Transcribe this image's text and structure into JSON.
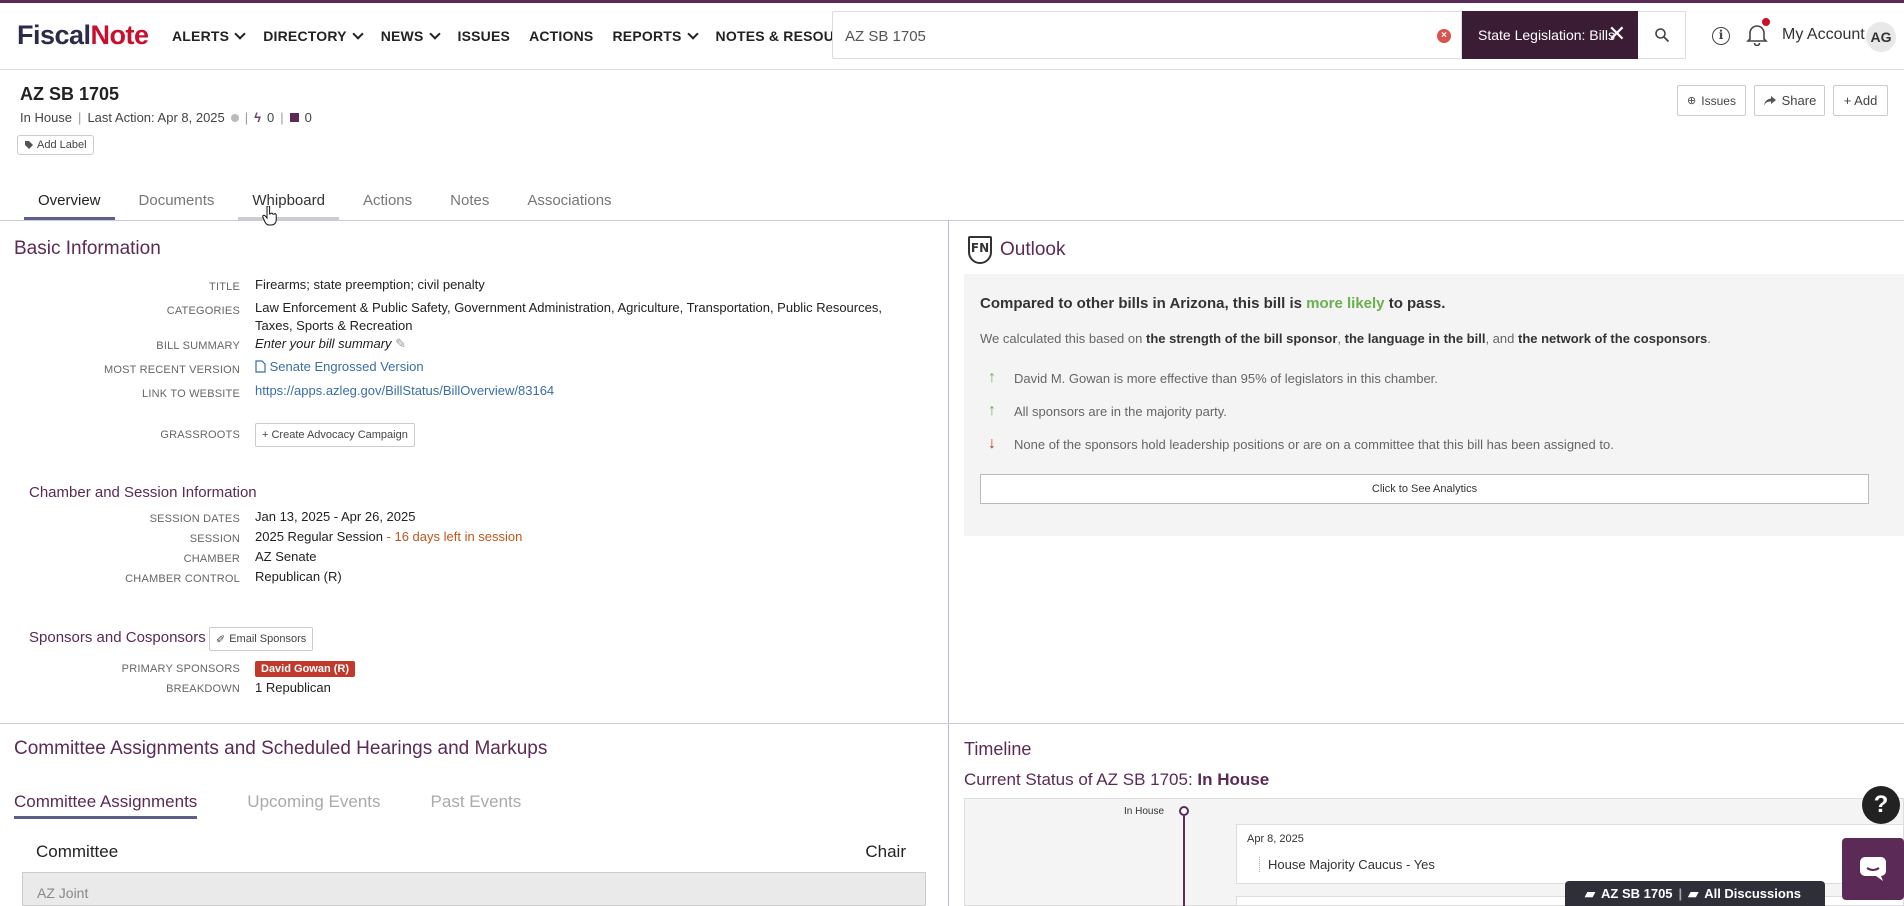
{
  "header": {
    "logo_fiscal": "Fiscal",
    "logo_note": "Note",
    "nav": [
      "ALERTS",
      "DIRECTORY",
      "NEWS",
      "ISSUES",
      "ACTIONS",
      "REPORTS",
      "NOTES & RESOURCES"
    ],
    "nav_has_chevron": [
      true,
      true,
      true,
      false,
      false,
      true,
      true
    ],
    "search_value": "AZ SB 1705",
    "search_scope": "State Legislation: Bills",
    "account_label": "My Account",
    "avatar_initials": "AG"
  },
  "bill": {
    "title": "AZ SB 1705",
    "status": "In House",
    "last_action": "Last Action: Apr 8, 2025",
    "actions_count": "0",
    "notes_count": "0",
    "add_label": "Add Label",
    "btn_issues": "Issues",
    "btn_share": "Share",
    "btn_add": "+ Add"
  },
  "tabs": [
    "Overview",
    "Documents",
    "Whipboard",
    "Actions",
    "Notes",
    "Associations"
  ],
  "basic": {
    "section_title": "Basic Information",
    "title_label": "TITLE",
    "title_value": "Firearms; state preemption; civil penalty",
    "categories_label": "CATEGORIES",
    "categories_value": "Law Enforcement & Public Safety, Government Administration, Agriculture, Transportation, Public Resources, Taxes, Sports & Recreation",
    "summary_label": "BILL SUMMARY",
    "summary_value": "Enter your bill summary",
    "version_label": "MOST RECENT VERSION",
    "version_value": "Senate Engrossed Version",
    "website_label": "LINK TO WEBSITE",
    "website_value": "https://apps.azleg.gov/BillStatus/BillOverview/83164",
    "grassroots_label": "GRASSROOTS",
    "grassroots_btn": "+ Create Advocacy Campaign"
  },
  "chamber": {
    "title": "Chamber and Session Information",
    "dates_label": "SESSION DATES",
    "dates_value": "Jan 13, 2025 - Apr 26, 2025",
    "session_label": "SESSION",
    "session_value": "2025 Regular Session",
    "session_left": " - 16 days left in session",
    "chamber_label": "CHAMBER",
    "chamber_value": "AZ Senate",
    "control_label": "CHAMBER CONTROL",
    "control_value": "Republican (R)"
  },
  "sponsors": {
    "title": "Sponsors and Cosponsors",
    "email_btn": "Email Sponsors",
    "primary_label": "PRIMARY SPONSORS",
    "primary_value": "David Gowan (R)",
    "breakdown_label": "BREAKDOWN",
    "breakdown_value": "1 Republican"
  },
  "outlook": {
    "title": "Outlook",
    "head_pre": "Compared to other bills in Arizona, this bill is ",
    "head_likely": "more likely",
    "head_post": " to pass.",
    "sub_pre": "We calculated this based on ",
    "sub_b1": "the strength of the bill sponsor",
    "sub_comma": ", ",
    "sub_b2": "the language in the bill",
    "sub_and": ", and ",
    "sub_b3": "the network of the cosponsors",
    "sub_end": ".",
    "reasons": [
      {
        "dir": "up",
        "text": "David M. Gowan is more effective than 95% of legislators in this chamber."
      },
      {
        "dir": "up",
        "text": "All sponsors are in the majority party."
      },
      {
        "dir": "down",
        "text": "None of the sponsors hold leadership positions or are on a committee that this bill has been assigned to."
      }
    ],
    "analytics_btn": "Click to See Analytics"
  },
  "committees": {
    "title": "Committee Assignments and Scheduled Hearings and Markups",
    "tabs": [
      "Committee Assignments",
      "Upcoming Events",
      "Past Events"
    ],
    "col_committee": "Committee",
    "col_chair": "Chair",
    "row1": "AZ Joint"
  },
  "timeline": {
    "title": "Timeline",
    "status_pre": "Current Status of AZ SB 1705: ",
    "status_value": "In House",
    "stage_label": "In House",
    "event_date": "Apr 8, 2025",
    "event_text": "House Majority Caucus - Yes"
  },
  "footer": {
    "discussion_bill": "AZ SB 1705",
    "discussion_sep": "|",
    "discussion_all": "All Discussions",
    "help": "?"
  },
  "colors": {
    "brand_purple": "#5b2a56",
    "accent_red": "#c8102e",
    "positive_green": "#6ab04c",
    "link_blue": "#3a6ea5"
  }
}
